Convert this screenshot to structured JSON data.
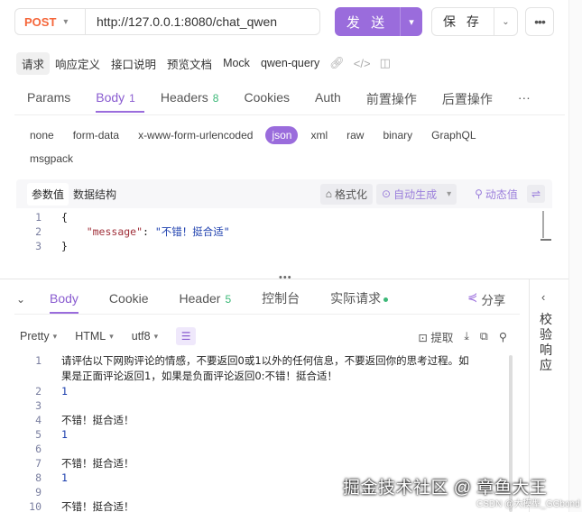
{
  "request": {
    "method": "POST",
    "url": "http://127.0.0.1:8080/chat_qwen",
    "send_label": "发 送",
    "save_label": "保 存"
  },
  "sub_tabs": [
    {
      "label": "请求",
      "active": true
    },
    {
      "label": "响应定义"
    },
    {
      "label": "接口说明"
    },
    {
      "label": "预览文档"
    },
    {
      "label": "Mock"
    },
    {
      "label": "qwen-query"
    }
  ],
  "main_tabs": [
    {
      "label": "Params",
      "count": ""
    },
    {
      "label": "Body",
      "count": "1",
      "active": true
    },
    {
      "label": "Headers",
      "count": "8"
    },
    {
      "label": "Cookies",
      "count": ""
    },
    {
      "label": "Auth",
      "count": ""
    },
    {
      "label": "前置操作",
      "count": ""
    },
    {
      "label": "后置操作",
      "count": ""
    }
  ],
  "body_types": [
    "none",
    "form-data",
    "x-www-form-urlencoded",
    "json",
    "xml",
    "raw",
    "binary",
    "GraphQL",
    "msgpack"
  ],
  "body_type_active": "json",
  "editor": {
    "seg_active": "参数值",
    "seg_other": "数据结构",
    "format_label": "格式化",
    "autogen_label": "自动生成",
    "dynamic_label": "动态值",
    "lines": [
      {
        "n": "1",
        "text": "{"
      },
      {
        "n": "2",
        "key": "\"message\"",
        "sep": ": ",
        "value": "\"不错！挺合适\""
      },
      {
        "n": "3",
        "text": "}"
      }
    ]
  },
  "response": {
    "tabs": [
      {
        "label": "Body",
        "count": "",
        "active": true
      },
      {
        "label": "Cookie",
        "count": ""
      },
      {
        "label": "Header",
        "count": "5"
      },
      {
        "label": "控制台",
        "count": ""
      },
      {
        "label": "实际请求",
        "count": "",
        "dot": true
      }
    ],
    "share_label": "分享",
    "format": "Pretty",
    "lang": "HTML",
    "encoding": "utf8",
    "extract_label": "提取",
    "lines": [
      {
        "n": "1",
        "text": "请评估以下网购评论的情感，不要返回0或1以外的任何信息，不要返回你的思考过程。如果是正面评论返回1，如果是负面评论返回0:不错！挺合适！",
        "wrap": true
      },
      {
        "n": "2",
        "text": "1",
        "num": true
      },
      {
        "n": "3",
        "text": ""
      },
      {
        "n": "4",
        "text": "不错！挺合适！"
      },
      {
        "n": "5",
        "text": "1",
        "num": true
      },
      {
        "n": "6",
        "text": ""
      },
      {
        "n": "7",
        "text": "不错！挺合适！"
      },
      {
        "n": "8",
        "text": "1",
        "num": true
      },
      {
        "n": "9",
        "text": ""
      },
      {
        "n": "10",
        "text": "不错！挺合适！"
      }
    ]
  },
  "side_panel_label": "校验响应",
  "watermark": "掘金技术社区 @ 章鱼大王",
  "watermark_sub": "CSDN @大模型_GGbond"
}
